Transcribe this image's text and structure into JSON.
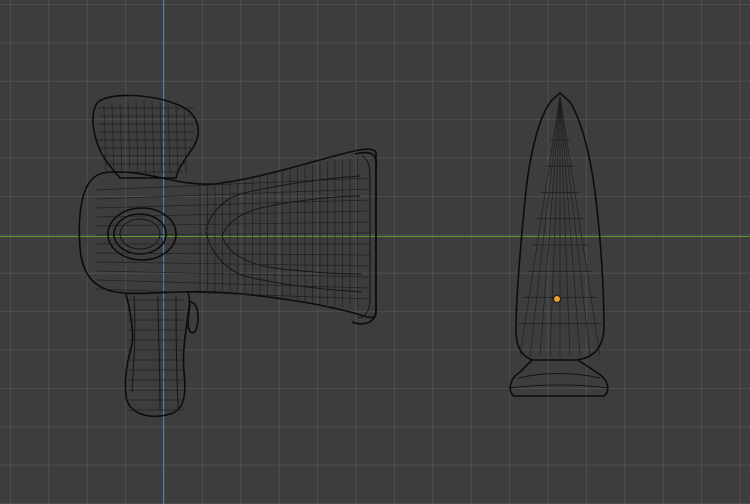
{
  "app": "3D Viewport",
  "viewport": {
    "background_color": "#3d3d3d",
    "grid_color": "#4a4a4a",
    "x_axis_color": "#5a9b2f",
    "y_axis_color": "#4a7ed0",
    "origin_color": "#f0a030"
  },
  "objects": [
    {
      "name": "megaphone-mesh",
      "display": "wireframe"
    },
    {
      "name": "cone-mesh",
      "display": "wireframe",
      "has_origin_marker": true
    }
  ]
}
